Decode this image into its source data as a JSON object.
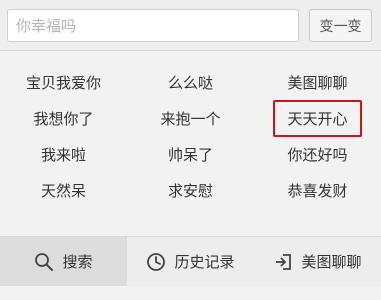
{
  "search": {
    "placeholder": "你幸福吗",
    "value": ""
  },
  "shuffle_button_label": "变一变",
  "phrases": [
    "宝贝我爱你",
    "么么哒",
    "美图聊聊",
    "我想你了",
    "来抱一个",
    "天天开心",
    "我来啦",
    "帅呆了",
    "你还好吗",
    "天然呆",
    "求安慰",
    "恭喜发财"
  ],
  "highlighted_phrase": "天天开心",
  "footer": {
    "search_label": "搜索",
    "history_label": "历史记录",
    "chat_label": "美图聊聊"
  },
  "colors": {
    "highlight_border": "#d0121b",
    "active_tab": "#dcdcdc"
  },
  "icons": [
    "search-icon",
    "clock-icon",
    "enter-icon"
  ]
}
